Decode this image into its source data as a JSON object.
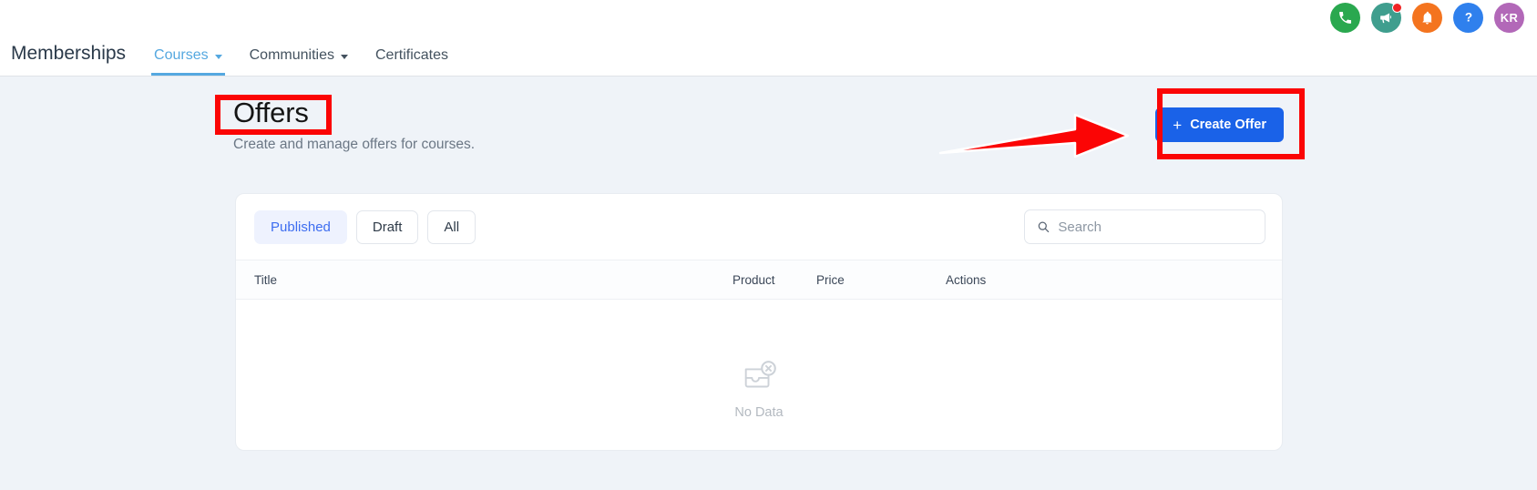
{
  "topbar": {
    "brand": "Memberships",
    "nav": [
      {
        "label": "Courses",
        "has_chevron": true,
        "active": true
      },
      {
        "label": "Communities",
        "has_chevron": true,
        "active": false
      },
      {
        "label": "Certificates",
        "has_chevron": false,
        "active": false
      }
    ],
    "icons": [
      {
        "name": "phone-icon",
        "color": "#2aa84f",
        "badge": false
      },
      {
        "name": "megaphone-icon",
        "color": "#3f9e8e",
        "badge": true
      },
      {
        "name": "bell-icon",
        "color": "#f4741f",
        "badge": false
      },
      {
        "name": "help-icon",
        "color": "#2f80ed",
        "badge": false
      }
    ],
    "avatar": {
      "initials": "KR",
      "color": "#b268b8"
    }
  },
  "page": {
    "title": "Offers",
    "subtitle": "Create and manage offers for courses.",
    "create_button": {
      "plus": "+",
      "label": "Create Offer",
      "color": "#1a62e8"
    }
  },
  "annotations": {
    "color": "#fb0505",
    "title_highlight": true,
    "button_highlight": true,
    "arrow_points_to": "Create Offer"
  },
  "card": {
    "filters": [
      {
        "label": "Published",
        "active": true
      },
      {
        "label": "Draft",
        "active": false
      },
      {
        "label": "All",
        "active": false
      }
    ],
    "search": {
      "value": "",
      "placeholder": "Search"
    },
    "table": {
      "columns": [
        "Title",
        "Product",
        "Price",
        "Actions"
      ],
      "rows": []
    },
    "empty_state": {
      "label": "No Data",
      "icon": "no-data-inbox-icon"
    }
  }
}
